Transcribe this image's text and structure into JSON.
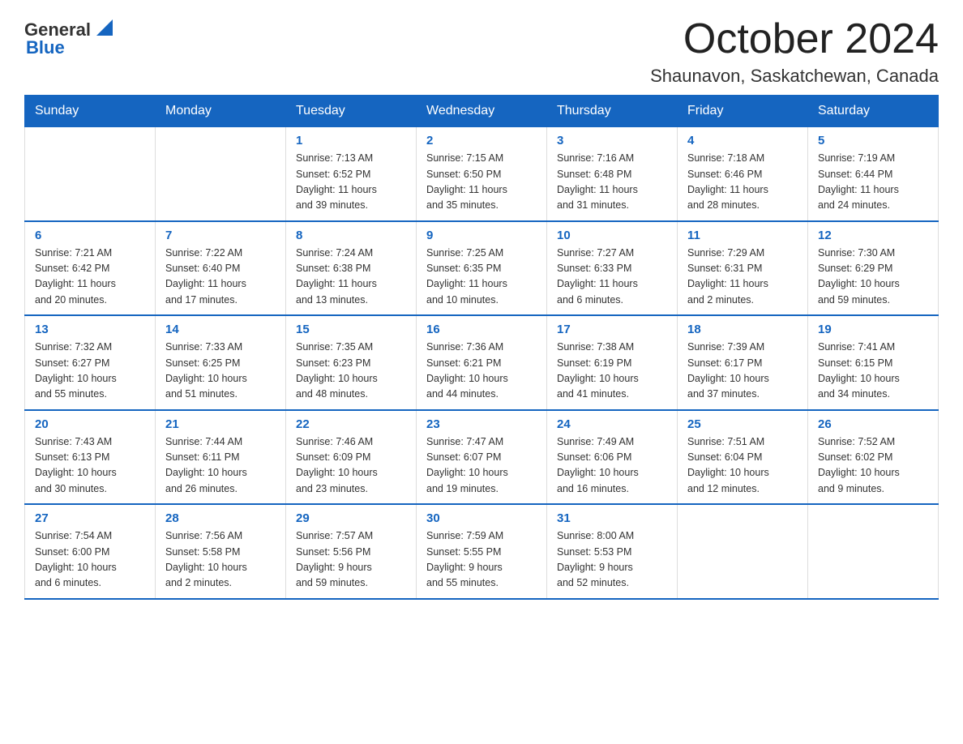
{
  "header": {
    "logo": {
      "general": "General",
      "blue": "Blue"
    },
    "month": "October 2024",
    "location": "Shaunavon, Saskatchewan, Canada"
  },
  "days_of_week": [
    "Sunday",
    "Monday",
    "Tuesday",
    "Wednesday",
    "Thursday",
    "Friday",
    "Saturday"
  ],
  "weeks": [
    [
      {
        "day": "",
        "info": ""
      },
      {
        "day": "",
        "info": ""
      },
      {
        "day": "1",
        "info": "Sunrise: 7:13 AM\nSunset: 6:52 PM\nDaylight: 11 hours\nand 39 minutes."
      },
      {
        "day": "2",
        "info": "Sunrise: 7:15 AM\nSunset: 6:50 PM\nDaylight: 11 hours\nand 35 minutes."
      },
      {
        "day": "3",
        "info": "Sunrise: 7:16 AM\nSunset: 6:48 PM\nDaylight: 11 hours\nand 31 minutes."
      },
      {
        "day": "4",
        "info": "Sunrise: 7:18 AM\nSunset: 6:46 PM\nDaylight: 11 hours\nand 28 minutes."
      },
      {
        "day": "5",
        "info": "Sunrise: 7:19 AM\nSunset: 6:44 PM\nDaylight: 11 hours\nand 24 minutes."
      }
    ],
    [
      {
        "day": "6",
        "info": "Sunrise: 7:21 AM\nSunset: 6:42 PM\nDaylight: 11 hours\nand 20 minutes."
      },
      {
        "day": "7",
        "info": "Sunrise: 7:22 AM\nSunset: 6:40 PM\nDaylight: 11 hours\nand 17 minutes."
      },
      {
        "day": "8",
        "info": "Sunrise: 7:24 AM\nSunset: 6:38 PM\nDaylight: 11 hours\nand 13 minutes."
      },
      {
        "day": "9",
        "info": "Sunrise: 7:25 AM\nSunset: 6:35 PM\nDaylight: 11 hours\nand 10 minutes."
      },
      {
        "day": "10",
        "info": "Sunrise: 7:27 AM\nSunset: 6:33 PM\nDaylight: 11 hours\nand 6 minutes."
      },
      {
        "day": "11",
        "info": "Sunrise: 7:29 AM\nSunset: 6:31 PM\nDaylight: 11 hours\nand 2 minutes."
      },
      {
        "day": "12",
        "info": "Sunrise: 7:30 AM\nSunset: 6:29 PM\nDaylight: 10 hours\nand 59 minutes."
      }
    ],
    [
      {
        "day": "13",
        "info": "Sunrise: 7:32 AM\nSunset: 6:27 PM\nDaylight: 10 hours\nand 55 minutes."
      },
      {
        "day": "14",
        "info": "Sunrise: 7:33 AM\nSunset: 6:25 PM\nDaylight: 10 hours\nand 51 minutes."
      },
      {
        "day": "15",
        "info": "Sunrise: 7:35 AM\nSunset: 6:23 PM\nDaylight: 10 hours\nand 48 minutes."
      },
      {
        "day": "16",
        "info": "Sunrise: 7:36 AM\nSunset: 6:21 PM\nDaylight: 10 hours\nand 44 minutes."
      },
      {
        "day": "17",
        "info": "Sunrise: 7:38 AM\nSunset: 6:19 PM\nDaylight: 10 hours\nand 41 minutes."
      },
      {
        "day": "18",
        "info": "Sunrise: 7:39 AM\nSunset: 6:17 PM\nDaylight: 10 hours\nand 37 minutes."
      },
      {
        "day": "19",
        "info": "Sunrise: 7:41 AM\nSunset: 6:15 PM\nDaylight: 10 hours\nand 34 minutes."
      }
    ],
    [
      {
        "day": "20",
        "info": "Sunrise: 7:43 AM\nSunset: 6:13 PM\nDaylight: 10 hours\nand 30 minutes."
      },
      {
        "day": "21",
        "info": "Sunrise: 7:44 AM\nSunset: 6:11 PM\nDaylight: 10 hours\nand 26 minutes."
      },
      {
        "day": "22",
        "info": "Sunrise: 7:46 AM\nSunset: 6:09 PM\nDaylight: 10 hours\nand 23 minutes."
      },
      {
        "day": "23",
        "info": "Sunrise: 7:47 AM\nSunset: 6:07 PM\nDaylight: 10 hours\nand 19 minutes."
      },
      {
        "day": "24",
        "info": "Sunrise: 7:49 AM\nSunset: 6:06 PM\nDaylight: 10 hours\nand 16 minutes."
      },
      {
        "day": "25",
        "info": "Sunrise: 7:51 AM\nSunset: 6:04 PM\nDaylight: 10 hours\nand 12 minutes."
      },
      {
        "day": "26",
        "info": "Sunrise: 7:52 AM\nSunset: 6:02 PM\nDaylight: 10 hours\nand 9 minutes."
      }
    ],
    [
      {
        "day": "27",
        "info": "Sunrise: 7:54 AM\nSunset: 6:00 PM\nDaylight: 10 hours\nand 6 minutes."
      },
      {
        "day": "28",
        "info": "Sunrise: 7:56 AM\nSunset: 5:58 PM\nDaylight: 10 hours\nand 2 minutes."
      },
      {
        "day": "29",
        "info": "Sunrise: 7:57 AM\nSunset: 5:56 PM\nDaylight: 9 hours\nand 59 minutes."
      },
      {
        "day": "30",
        "info": "Sunrise: 7:59 AM\nSunset: 5:55 PM\nDaylight: 9 hours\nand 55 minutes."
      },
      {
        "day": "31",
        "info": "Sunrise: 8:00 AM\nSunset: 5:53 PM\nDaylight: 9 hours\nand 52 minutes."
      },
      {
        "day": "",
        "info": ""
      },
      {
        "day": "",
        "info": ""
      }
    ]
  ]
}
